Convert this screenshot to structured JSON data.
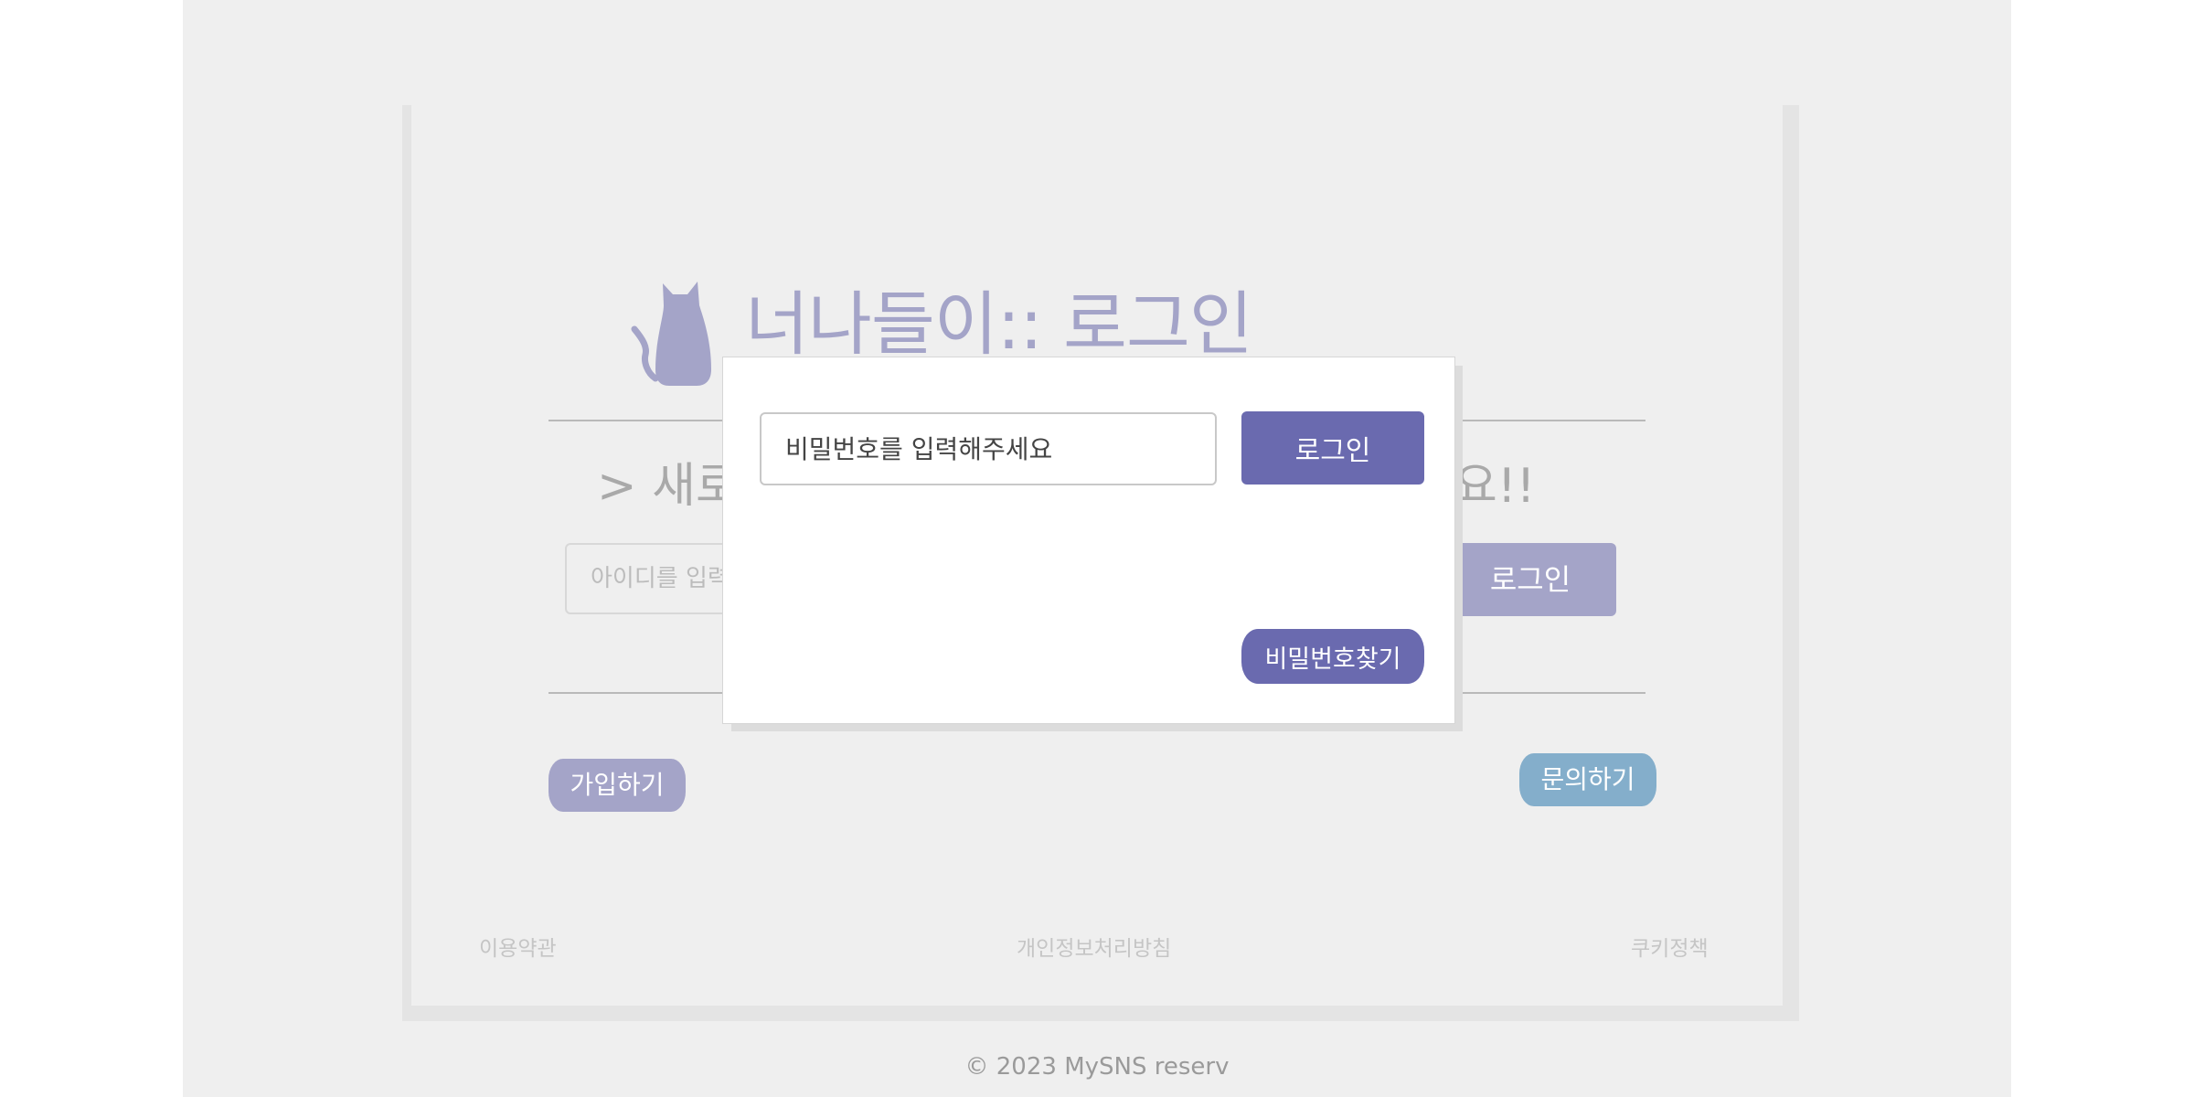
{
  "brand": {
    "logo_icon": "cat-icon",
    "title": "너나들이:: 로그인"
  },
  "subtitle": {
    "visible_start": "> 새로",
    "visible_end": "요!!"
  },
  "background_form": {
    "id_placeholder_visible": "아이디를 입력",
    "login_label": "로그인"
  },
  "actions": {
    "signup_label": "가입하기",
    "inquiry_label": "문의하기"
  },
  "footer": {
    "links": [
      "이용약관",
      "개인정보처리방침",
      "쿠키정책"
    ],
    "copyright": "© 2023 MySNS reserv"
  },
  "modal": {
    "password_placeholder": "비밀번호를 입력해주세요",
    "login_label": "로그인",
    "find_password_label": "비밀번호찾기"
  },
  "colors": {
    "accent": "#6a6aaf",
    "accent_muted": "#a4a4c8",
    "inquiry": "#84aecb",
    "page_bg": "#efefef"
  }
}
